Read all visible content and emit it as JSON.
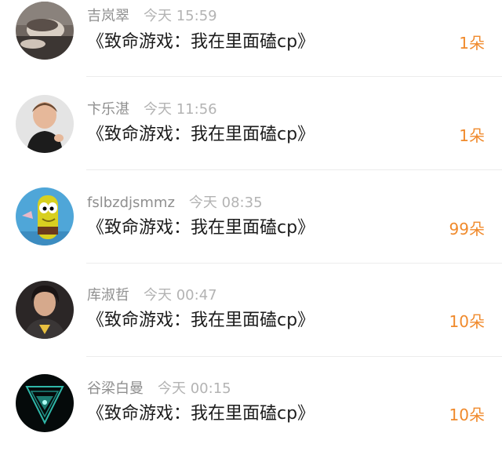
{
  "gifts": [
    {
      "username": "吉岚翠",
      "time": "今天 15:59",
      "title": "《致命游戏：我在里面磕cp》",
      "amount": "1朵"
    },
    {
      "username": "卞乐湛",
      "time": "今天 11:56",
      "title": "《致命游戏：我在里面磕cp》",
      "amount": "1朵"
    },
    {
      "username": "fslbzdjsmmz",
      "time": "今天 08:35",
      "title": "《致命游戏：我在里面磕cp》",
      "amount": "99朵"
    },
    {
      "username": "库淑哲",
      "time": "今天 00:47",
      "title": "《致命游戏：我在里面磕cp》",
      "amount": "10朵"
    },
    {
      "username": "谷梁白曼",
      "time": "今天 00:15",
      "title": "《致命游戏：我在里面磕cp》",
      "amount": "10朵"
    }
  ],
  "colors": {
    "accent": "#f08a2c",
    "username": "#8f8f8f",
    "time": "#b3b3b3",
    "title": "#1c1c1c",
    "divider": "#ececec"
  }
}
